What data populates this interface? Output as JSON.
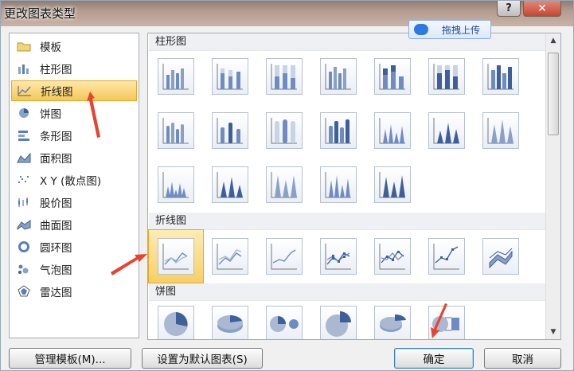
{
  "window": {
    "title": "更改图表类型",
    "help": "?",
    "close": "✕"
  },
  "upload_badge": {
    "label": "拖拽上传",
    "icon": "cloud-upload-icon"
  },
  "categories": [
    {
      "label": "模板",
      "icon": "folder-icon"
    },
    {
      "label": "柱形图",
      "icon": "column-chart-icon"
    },
    {
      "label": "折线图",
      "icon": "line-chart-icon",
      "selected": true
    },
    {
      "label": "饼图",
      "icon": "pie-chart-icon"
    },
    {
      "label": "条形图",
      "icon": "bar-chart-icon"
    },
    {
      "label": "面积图",
      "icon": "area-chart-icon"
    },
    {
      "label": "X Y (散点图)",
      "icon": "scatter-chart-icon"
    },
    {
      "label": "股价图",
      "icon": "stock-chart-icon"
    },
    {
      "label": "曲面图",
      "icon": "surface-chart-icon"
    },
    {
      "label": "圆环图",
      "icon": "doughnut-chart-icon"
    },
    {
      "label": "气泡图",
      "icon": "bubble-chart-icon"
    },
    {
      "label": "雷达图",
      "icon": "radar-chart-icon"
    }
  ],
  "gallery": {
    "sections": [
      {
        "title": "柱形图",
        "count": 19
      },
      {
        "title": "折线图",
        "count": 7,
        "selected_index": 0
      },
      {
        "title": "饼图",
        "count": 6
      }
    ]
  },
  "buttons": {
    "manage_templates": "管理模板(M)...",
    "set_default": "设置为默认图表(S)",
    "ok": "确定",
    "cancel": "取消"
  },
  "colors": {
    "selection": "#f6c75a",
    "annotation_arrow": "#e8432e",
    "chart_blue": "#5b7db8"
  }
}
